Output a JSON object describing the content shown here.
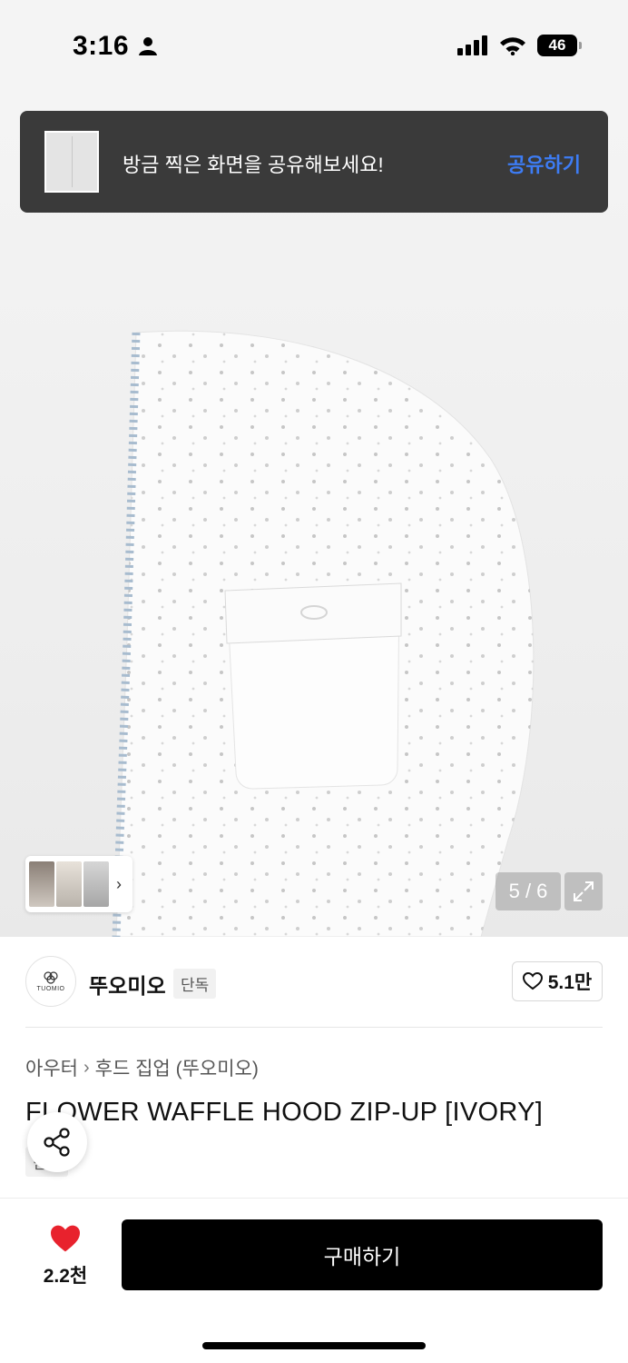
{
  "status_bar": {
    "time": "3:16",
    "battery": "46"
  },
  "toast": {
    "message": "방금 찍은 화면을 공유해보세요!",
    "action": "공유하기"
  },
  "gallery": {
    "counter": "5 / 6"
  },
  "brand": {
    "logo_text": "TUOMIO",
    "name": "뚜오미오",
    "tag": "단독",
    "likes": "5.1만"
  },
  "breadcrumb": {
    "category": "아우터",
    "subcategory": "후드 집업 (뚜오미오)"
  },
  "product": {
    "title": "FLOWER WAFFLE HOOD ZIP-UP [IVORY]",
    "tag": "단독"
  },
  "bottom_bar": {
    "favorite_count": "2.2천",
    "buy_label": "구매하기"
  },
  "colors": {
    "accent_blue": "#3d7cf4",
    "heart_red": "#e8222d",
    "toast_bg": "#3a3a3a"
  }
}
